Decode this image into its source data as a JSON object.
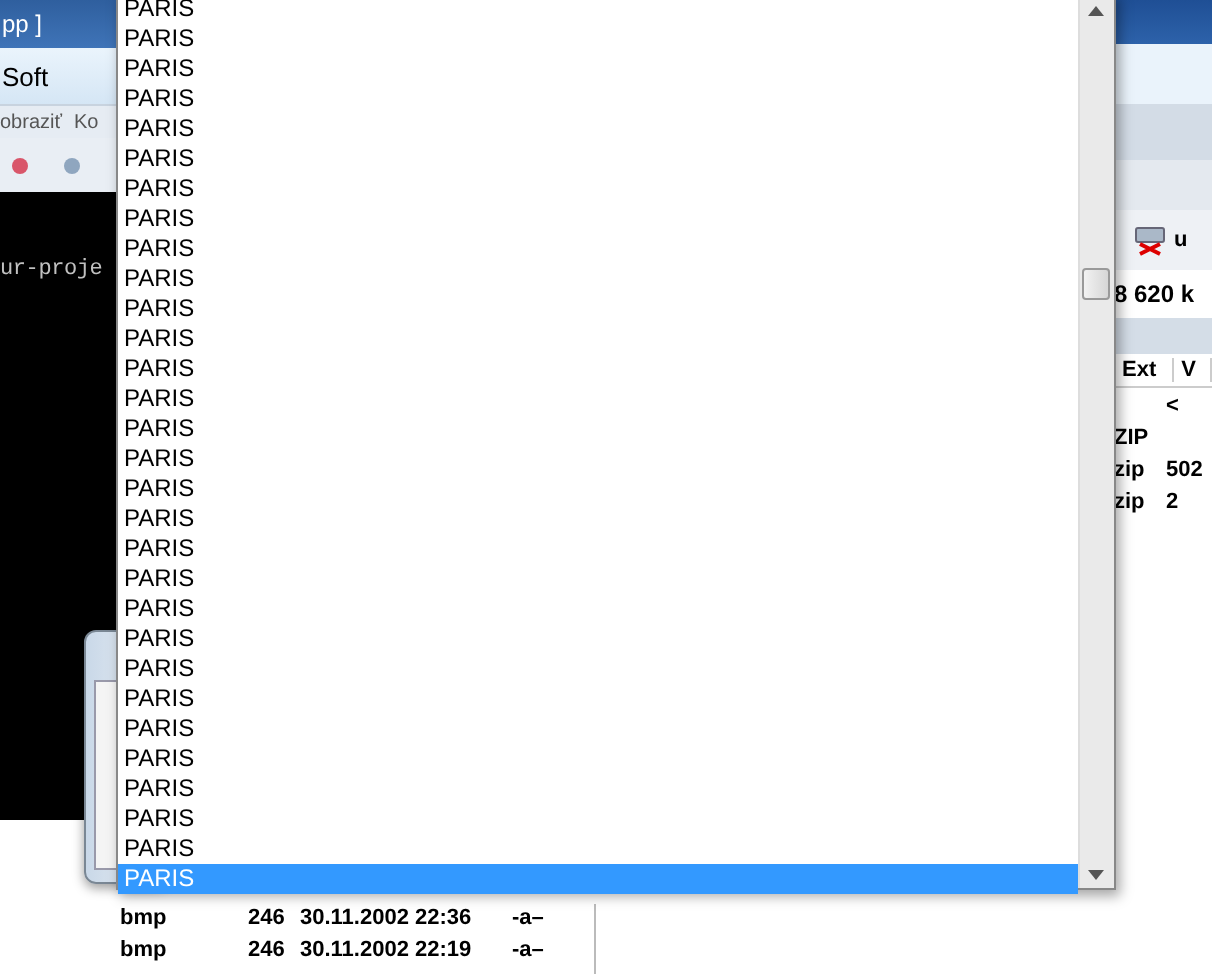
{
  "left_window": {
    "title": "pp ]",
    "app_name": "Soft",
    "menu": [
      "obraziť",
      "Ko"
    ],
    "console_text": "ur-proje"
  },
  "right_window": {
    "toolbar_label": "u",
    "free_space": "8 620 k",
    "columns": [
      "Ext",
      "V"
    ],
    "rows": [
      {
        "v": "<"
      },
      {
        "ext": "ZIP"
      },
      {
        "ext": "zip",
        "v": "502"
      },
      {
        "ext": "zip",
        "v": "2"
      }
    ]
  },
  "file_rows": [
    {
      "ext": "bmp",
      "size": "246",
      "date": "30.11.2002 22:36",
      "attrs": "-a–"
    },
    {
      "ext": "bmp",
      "size": "246",
      "date": "30.11.2002 22:19",
      "attrs": "-a–"
    }
  ],
  "dropdown": {
    "items": [
      {
        "label": "PARIS",
        "selected": false
      },
      {
        "label": "PARIS",
        "selected": false
      },
      {
        "label": "PARIS",
        "selected": false
      },
      {
        "label": "PARIS",
        "selected": false
      },
      {
        "label": "PARIS",
        "selected": false
      },
      {
        "label": "PARIS",
        "selected": false
      },
      {
        "label": "PARIS",
        "selected": false
      },
      {
        "label": "PARIS",
        "selected": false
      },
      {
        "label": "PARIS",
        "selected": false
      },
      {
        "label": "PARIS",
        "selected": false
      },
      {
        "label": "PARIS",
        "selected": false
      },
      {
        "label": "PARIS",
        "selected": false
      },
      {
        "label": "PARIS",
        "selected": false
      },
      {
        "label": "PARIS",
        "selected": false
      },
      {
        "label": "PARIS",
        "selected": false
      },
      {
        "label": "PARIS",
        "selected": false
      },
      {
        "label": "PARIS",
        "selected": false
      },
      {
        "label": "PARIS",
        "selected": false
      },
      {
        "label": "PARIS",
        "selected": false
      },
      {
        "label": "PARIS",
        "selected": false
      },
      {
        "label": "PARIS",
        "selected": false
      },
      {
        "label": "PARIS",
        "selected": false
      },
      {
        "label": "PARIS",
        "selected": false
      },
      {
        "label": "PARIS",
        "selected": false
      },
      {
        "label": "PARIS",
        "selected": false
      },
      {
        "label": "PARIS",
        "selected": false
      },
      {
        "label": "PARIS",
        "selected": false
      },
      {
        "label": "PARIS",
        "selected": false
      },
      {
        "label": "PARIS",
        "selected": false
      },
      {
        "label": "PARIS",
        "selected": true
      }
    ]
  }
}
